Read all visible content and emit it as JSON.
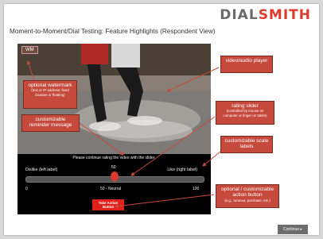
{
  "logo": {
    "part1": "DIAL",
    "part2": "SMITH"
  },
  "title": "Moment-to-Moment/Dial Testing: Feature Highlights (Respondent View)",
  "player": {
    "watermark_badge": "WM",
    "prompt": "Please continue rating the video with the slider.",
    "left_label": "Dislike (left label)",
    "right_label": "Like (right label)",
    "thumb_value": "50",
    "scale_min": "0",
    "scale_mid": "50 - Neutral",
    "scale_max": "100",
    "action_button": "Take Action Button"
  },
  "callouts": {
    "video_player": "video/audio player",
    "watermark": {
      "title": "optional watermark",
      "sub": "(text or IP address; fixed location or floating)"
    },
    "reminder": "customizable reminder message",
    "rating_slider": {
      "title": "rating slider",
      "sub": "(controlled by mouse on computer or finger on tablet)"
    },
    "scale_labels": "customizable scale labels",
    "action_button": {
      "title": "optional / customizable action button",
      "sub": "(e.g., tuneout, purchase, etc.)"
    }
  },
  "continue_button": "Continue ▸",
  "colors": {
    "accent": "#c64a3c",
    "button_red": "#e0201a",
    "logo_red": "#e03a2c"
  }
}
